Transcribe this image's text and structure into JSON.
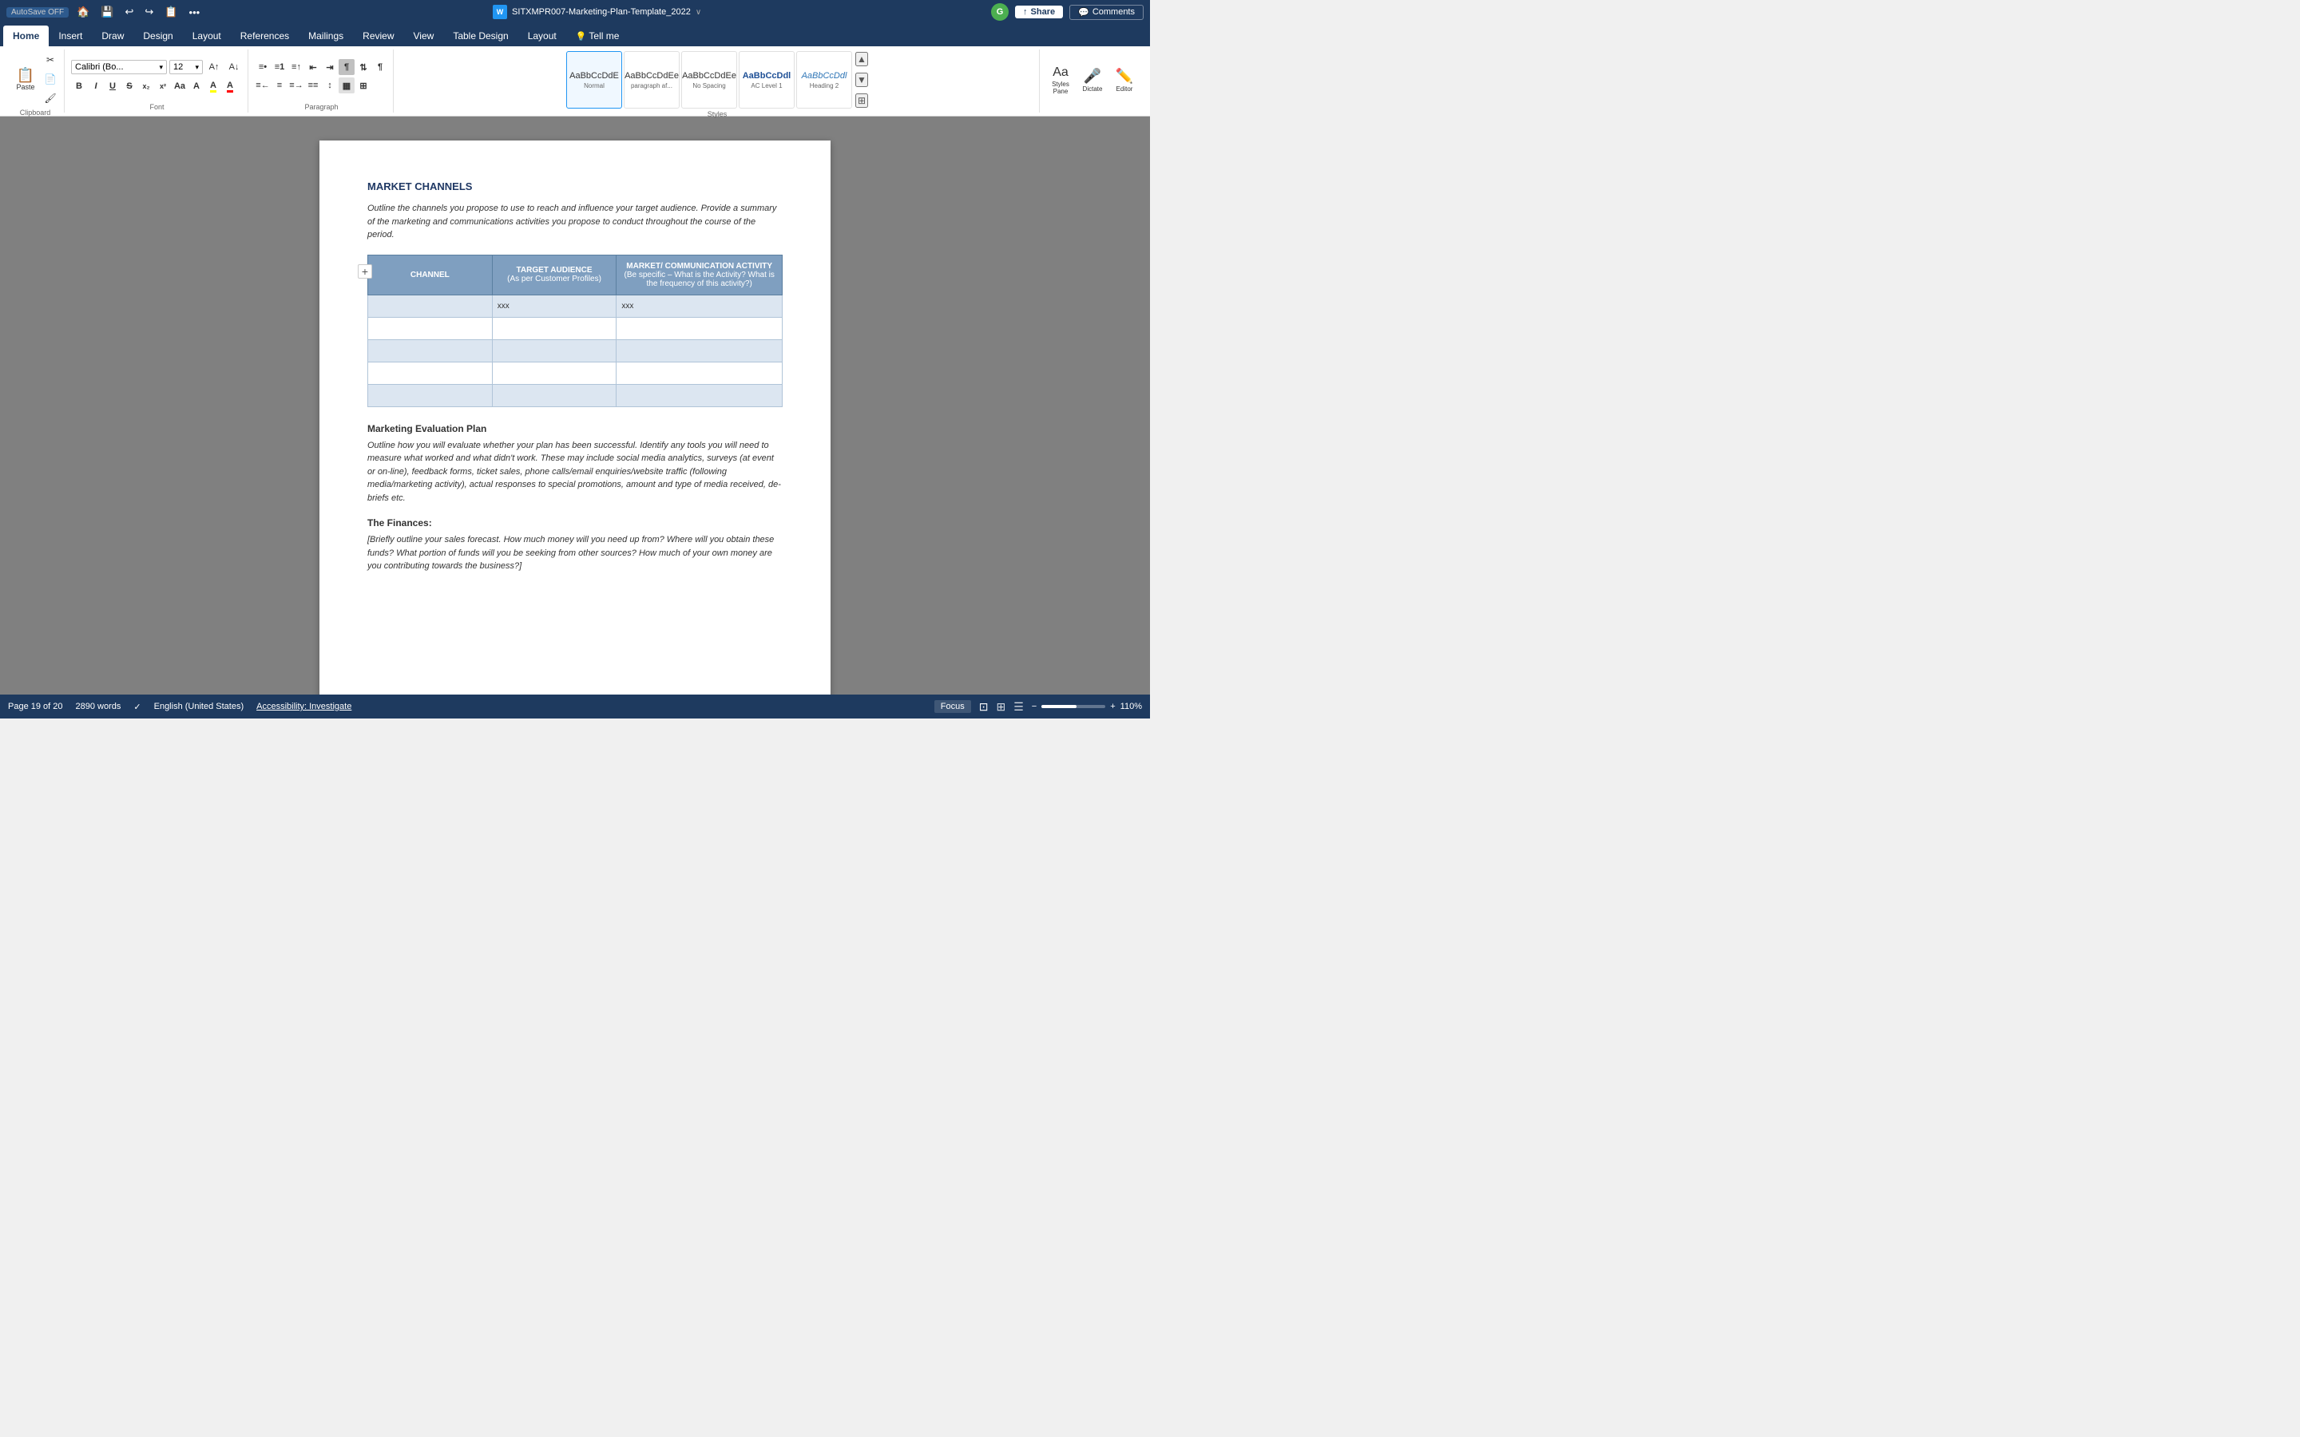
{
  "title_bar": {
    "autosave": "AutoSave  OFF",
    "title": "SITXMPR007-Marketing-Plan-Template_2022",
    "share_label": "Share",
    "comments_label": "Comments"
  },
  "ribbon_tabs": {
    "tabs": [
      "Home",
      "Insert",
      "Draw",
      "Design",
      "Layout",
      "References",
      "Mailings",
      "Review",
      "View",
      "Table Design",
      "Layout",
      "Tell me"
    ],
    "active": "Home"
  },
  "ribbon": {
    "paste_label": "Paste",
    "font_name": "Calibri (Bo...",
    "font_size": "12",
    "bold": "B",
    "italic": "I",
    "underline": "U",
    "strikethrough": "S",
    "subscript": "x₂",
    "superscript": "x²",
    "styles": [
      {
        "name": "Normal",
        "preview": "AaBbCcDdE"
      },
      {
        "name": "paragraph af...",
        "preview": "AaBbCcDdEe"
      },
      {
        "name": "No Spacing",
        "preview": "AaBbCcDdEe"
      },
      {
        "name": "AC Level 1",
        "preview": "AaBbCcDdl"
      },
      {
        "name": "Heading 2",
        "preview": "AaBbCcDdl"
      }
    ],
    "styles_pane_label": "Styles\nPane",
    "dictate_label": "Dictate",
    "editor_label": "Editor"
  },
  "document": {
    "section_title": "MARKET CHANNELS",
    "intro_text": "Outline the channels you propose to use to reach and influence your target audience.  Provide a summary of the marketing and communications activities you propose to conduct throughout the course of the period.",
    "table": {
      "headers": [
        "CHANNEL",
        "TARGET AUDIENCE\n(As per Customer Profiles)",
        "MARKET/ COMMUNICATION ACTIVITY\n(Be specific – What is the Activity? What is the frequency of this activity?)"
      ],
      "rows": [
        [
          "",
          "xxx",
          "xxx"
        ],
        [
          "",
          "",
          ""
        ],
        [
          "",
          "",
          ""
        ],
        [
          "",
          "",
          ""
        ],
        [
          "",
          "",
          ""
        ]
      ]
    },
    "eval_heading": "Marketing Evaluation Plan",
    "eval_text": "Outline how you will evaluate whether your plan has been successful.  Identify any tools you will need to measure what worked and what didn't work.  These may include social media analytics, surveys (at event or on-line), feedback forms, ticket sales, phone calls/email enquiries/website traffic (following media/marketing activity), actual responses to special promotions, amount and type of media received, de-briefs etc.",
    "finance_heading": "The Finances:",
    "finance_text": "[Briefly outline your sales forecast. How much money will you need up from? Where will you obtain these funds? What portion of funds will you be seeking from other sources? How much of your own money are you contributing towards the business?]"
  },
  "status_bar": {
    "page": "Page 19 of 20",
    "words": "2890 words",
    "lang": "English (United States)",
    "accessibility": "Accessibility: Investigate",
    "focus": "Focus",
    "zoom": "110%"
  },
  "collaborator": {
    "initial": "G",
    "color": "#4caf50"
  }
}
